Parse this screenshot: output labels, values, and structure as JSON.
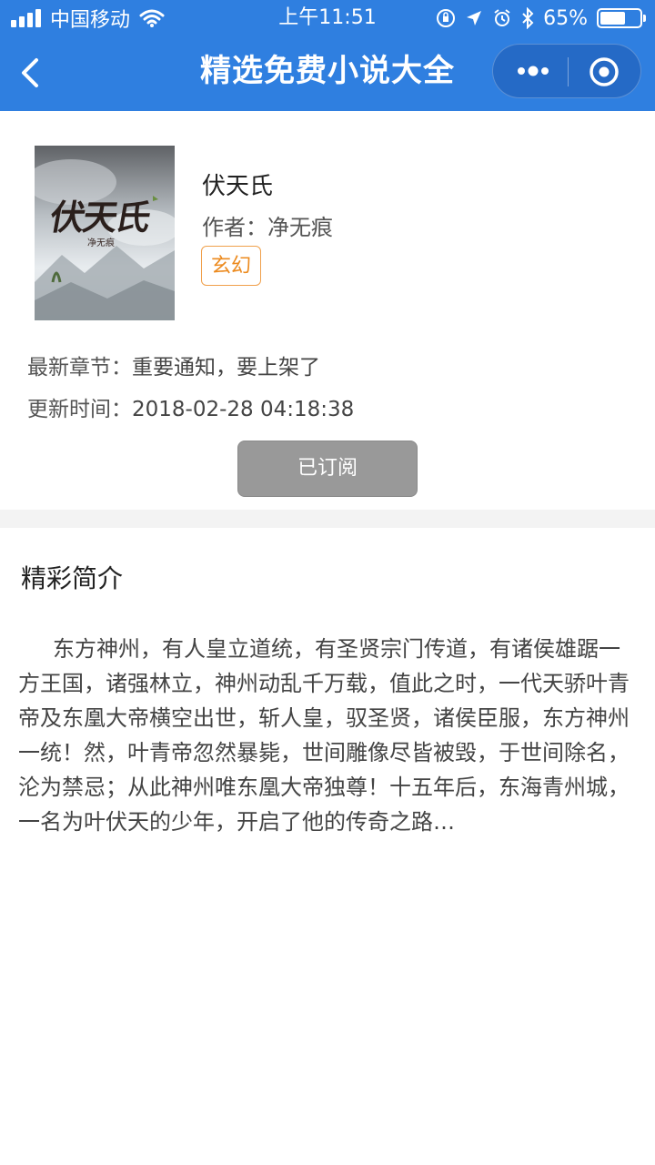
{
  "status_bar": {
    "carrier": "中国移动",
    "time": "上午11:51",
    "battery": "65%",
    "battery_level": 0.65
  },
  "navbar": {
    "title": "精选免费小说大全"
  },
  "book": {
    "cover": {
      "title": "伏天氏",
      "author": "净无痕"
    },
    "title": "伏天氏",
    "author_line": "作者：净无痕",
    "genre": "玄幻",
    "latest_chapter_label": "最新章节：",
    "latest_chapter": "重要通知，要上架了",
    "update_time_label": "更新时间：",
    "update_time": "2018-02-28 04:18:38",
    "subscribe_label": "已订阅"
  },
  "intro": {
    "heading": "精彩简介",
    "text": "东方神州，有人皇立道统，有圣贤宗门传道，有诸侯雄踞一方王国，诸强林立，神州动乱千万载，值此之时，一代天骄叶青帝及东凰大帝横空出世，斩人皇，驭圣贤，诸侯臣服，东方神州一统！然，叶青帝忽然暴毙，世间雕像尽皆被毁，于世间除名，沦为禁忌；从此神州唯东凰大帝独尊！十五年后，东海青州城，一名为叶伏天的少年，开启了他的传奇之路…"
  },
  "colors": {
    "header_bg": "#2f7fe0",
    "tag": "#ec8a1e",
    "button_bg": "#999999"
  }
}
